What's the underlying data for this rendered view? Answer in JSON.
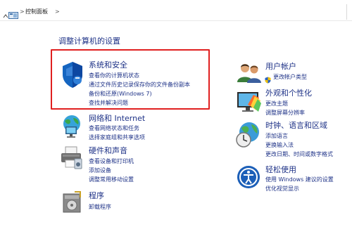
{
  "breadcrumb": {
    "up_glyph": "^",
    "separator": ">",
    "location": "控制面板",
    "icon": "control-panel-icon"
  },
  "heading": "调整计算机的设置",
  "left": {
    "system": {
      "title": "系统和安全",
      "links": [
        "查看你的计算机状态",
        "通过文件历史记录保存你的文件备份副本",
        "备份和还原(Windows 7)",
        "查找并解决问题"
      ]
    },
    "network": {
      "title": "网络和 Internet",
      "links": [
        "查看网络状态和任务",
        "选择家庭组和共享选项"
      ]
    },
    "hardware": {
      "title": "硬件和声音",
      "links": [
        "查看设备和打印机",
        "添加设备",
        "调整常用移动设置"
      ]
    },
    "programs": {
      "title": "程序",
      "links": [
        "卸载程序"
      ]
    }
  },
  "right": {
    "users": {
      "title": "用户帐户",
      "links": [
        "更改帐户类型"
      ]
    },
    "appearance": {
      "title": "外观和个性化",
      "links": [
        "更改主题",
        "调整屏幕分辨率"
      ]
    },
    "clock": {
      "title": "时钟、语言和区域",
      "links": [
        "添加语言",
        "更换输入法",
        "更改日期、时间或数字格式"
      ]
    },
    "ease": {
      "title": "轻松使用",
      "links": [
        "使用 Windows 建议的设置",
        "优化视觉显示"
      ]
    }
  },
  "colors": {
    "link": "#1e3287",
    "highlight": "#e02020"
  }
}
